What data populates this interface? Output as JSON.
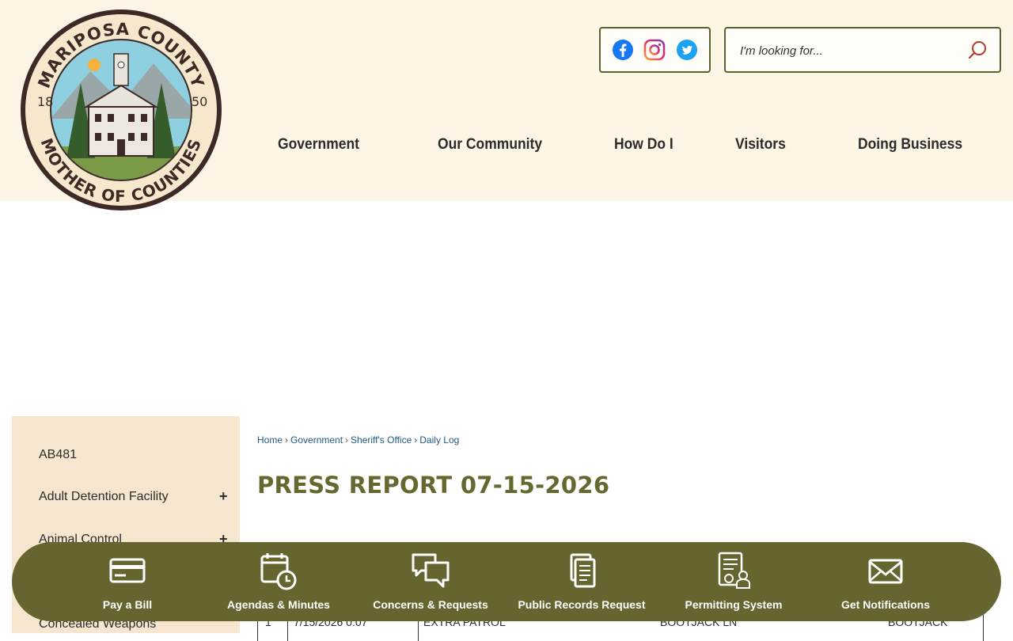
{
  "header": {
    "logo": {
      "top_text": "MARIPOSA COUNTY",
      "bottom_text": "MOTHER OF COUNTIES",
      "year_left": "18",
      "year_right": "50"
    },
    "social": [
      "facebook-icon",
      "instagram-icon",
      "twitter-icon"
    ],
    "search": {
      "placeholder": "I'm looking for..."
    },
    "nav": [
      "Government",
      "Our Community",
      "How Do I",
      "Visitors",
      "Doing Business"
    ]
  },
  "sidebar": {
    "items": [
      {
        "label": "AB481",
        "expandable": false
      },
      {
        "label": "Adult Detention Facility",
        "expandable": true
      },
      {
        "label": "Animal Control",
        "expandable": true
      },
      {
        "label": "Concealed Weapons",
        "expandable": false
      }
    ],
    "expand_symbol": "+"
  },
  "breadcrumb": [
    "Home",
    "Government",
    "Sheriff's Office",
    "Daily Log"
  ],
  "breadcrumb_sep": "›",
  "page_title": "PRESS REPORT 07-15-2026",
  "table": {
    "rows": [
      {
        "num": "1",
        "datetime": "7/15/2026 0:07",
        "type": "EXTRA PATROL",
        "location": "BOOTJACK LN",
        "area": "BOOTJACK"
      }
    ]
  },
  "quick_links": [
    {
      "label": "Pay a Bill",
      "icon": "credit-card-icon"
    },
    {
      "label": "Agendas & Minutes",
      "icon": "calendar-clock-icon"
    },
    {
      "label": "Concerns & Requests",
      "icon": "chat-bubbles-icon"
    },
    {
      "label": "Public Records Request",
      "icon": "documents-icon"
    },
    {
      "label": "Permitting System",
      "icon": "permit-document-icon"
    },
    {
      "label": "Get Notifications",
      "icon": "envelope-icon"
    }
  ],
  "colors": {
    "header_bg": "#fdf5e6",
    "accent_olive": "#66652f",
    "sidebar_bg": "#f6e6cf",
    "link_blue": "#1e5a80"
  }
}
